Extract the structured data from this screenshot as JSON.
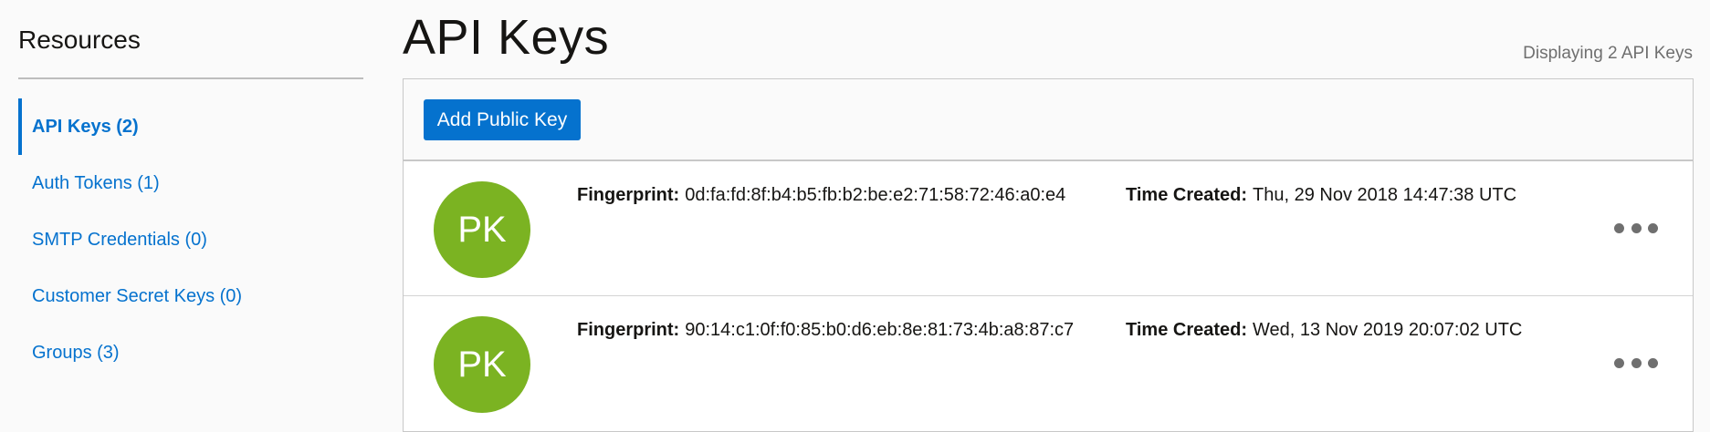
{
  "sidebar": {
    "title": "Resources",
    "items": [
      {
        "label": "API Keys (2)",
        "active": true
      },
      {
        "label": "Auth Tokens (1)",
        "active": false
      },
      {
        "label": "SMTP Credentials (0)",
        "active": false
      },
      {
        "label": "Customer Secret Keys (0)",
        "active": false
      },
      {
        "label": "Groups (3)",
        "active": false
      }
    ]
  },
  "main": {
    "title": "API Keys",
    "count_text": "Displaying 2 API Keys",
    "add_button_label": "Add Public Key",
    "keys": [
      {
        "avatar_initials": "PK",
        "fingerprint_label": "Fingerprint:",
        "fingerprint": "0d:fa:fd:8f:b4:b5:fb:b2:be:e2:71:58:72:46:a0:e4",
        "created_label": "Time Created:",
        "created": "Thu, 29 Nov 2018 14:47:38 UTC"
      },
      {
        "avatar_initials": "PK",
        "fingerprint_label": "Fingerprint:",
        "fingerprint": "90:14:c1:0f:f0:85:b0:d6:eb:8e:81:73:4b:a8:87:c7",
        "created_label": "Time Created:",
        "created": "Wed, 13 Nov 2019 20:07:02 UTC"
      }
    ]
  },
  "colors": {
    "accent": "#0572ce",
    "avatar": "#7bb322",
    "muted_text": "#6f6f6f"
  },
  "icons": {
    "row_menu": "more-horizontal-icon"
  }
}
